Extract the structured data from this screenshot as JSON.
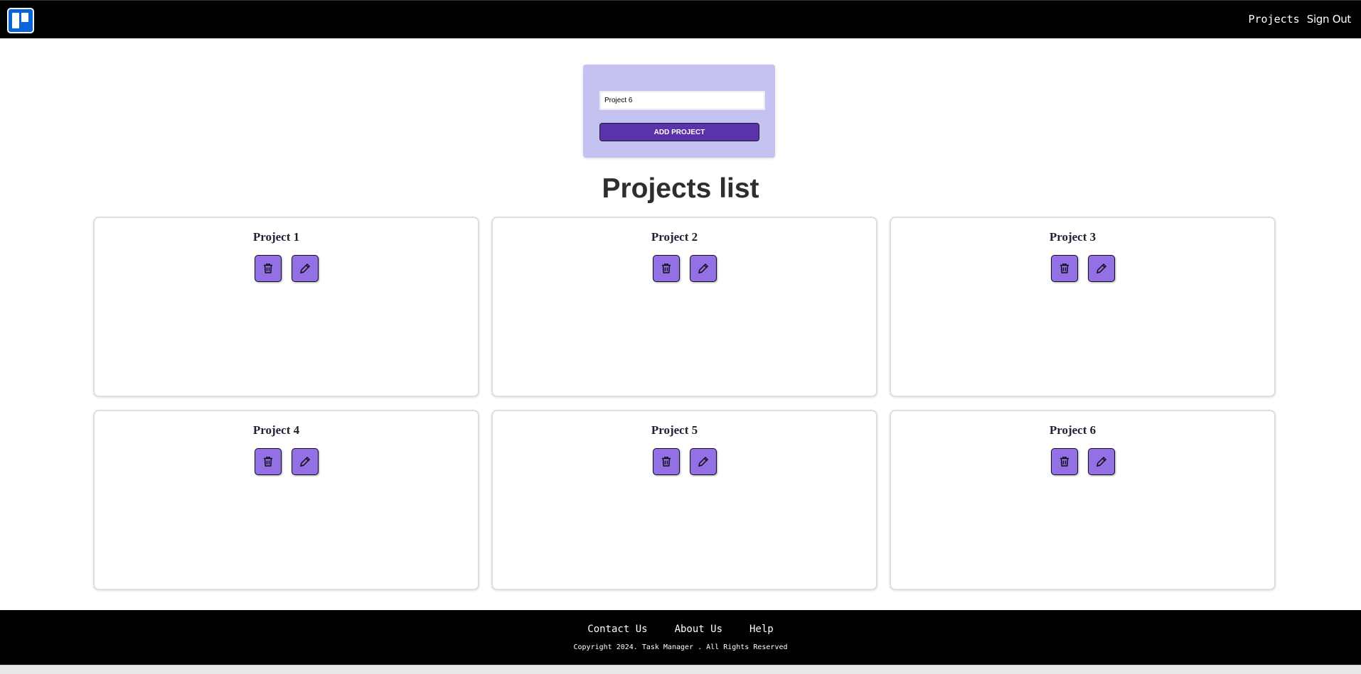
{
  "nav": {
    "logo_icon": "trello-board-icon",
    "links": [
      "Projects",
      "Sign Out"
    ]
  },
  "add_project": {
    "input_value": "Project 6",
    "button_label": "ADD PROJECT"
  },
  "projects_section": {
    "title": "Projects list"
  },
  "projects": [
    {
      "name": "Project 1",
      "delete_icon": "trash-icon",
      "edit_icon": "pencil-icon"
    },
    {
      "name": "Project 2",
      "delete_icon": "trash-icon",
      "edit_icon": "pencil-icon"
    },
    {
      "name": "Project 3",
      "delete_icon": "trash-icon",
      "edit_icon": "pencil-icon"
    },
    {
      "name": "Project 4",
      "delete_icon": "trash-icon",
      "edit_icon": "pencil-icon"
    },
    {
      "name": "Project 5",
      "delete_icon": "trash-icon",
      "edit_icon": "pencil-icon"
    },
    {
      "name": "Project 6",
      "delete_icon": "trash-icon",
      "edit_icon": "pencil-icon"
    }
  ],
  "footer": {
    "links": [
      "Contact Us",
      "About Us",
      "Help"
    ],
    "copyright": "Copyright 2024. Task Manager . All Rights Reserved"
  },
  "colors": {
    "header_bg": "#000000",
    "form_bg": "#c3c2f1",
    "primary_button": "#5a33aa",
    "icon_button": "#9370e6",
    "logo_blue": "#0a66d6"
  }
}
